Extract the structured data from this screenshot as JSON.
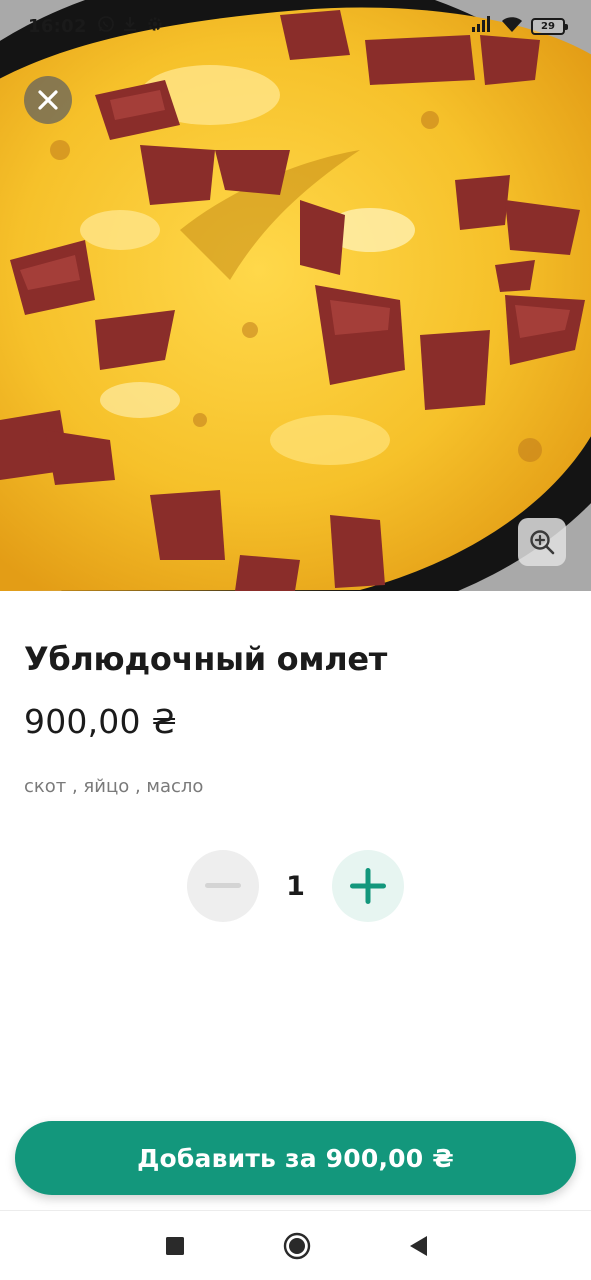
{
  "status_bar": {
    "time": "16:02",
    "battery": "29",
    "left_icons": [
      "whatsapp-icon",
      "download-icon",
      "settings-gear-icon"
    ],
    "right_icons": [
      "signal-icon",
      "wifi-icon",
      "battery-icon"
    ]
  },
  "hero": {
    "image": "omelette-photo",
    "close_icon": "close-icon",
    "zoom_icon": "zoom-in-icon"
  },
  "product": {
    "title": "Ублюдочный омлет",
    "price": "900,00 ₴",
    "ingredients": "скот , яйцо , масло"
  },
  "quantity": {
    "value": "1",
    "minus_icon": "minus-icon",
    "plus_icon": "plus-icon"
  },
  "cta": {
    "label": "Добавить за 900,00 ₴"
  },
  "nav": {
    "icons": [
      "recents-icon",
      "home-icon",
      "back-icon"
    ]
  },
  "colors": {
    "accent": "#13977c",
    "accent_light": "#e7f5f1",
    "text": "#1b1b1b",
    "muted": "#7a7a7a"
  }
}
